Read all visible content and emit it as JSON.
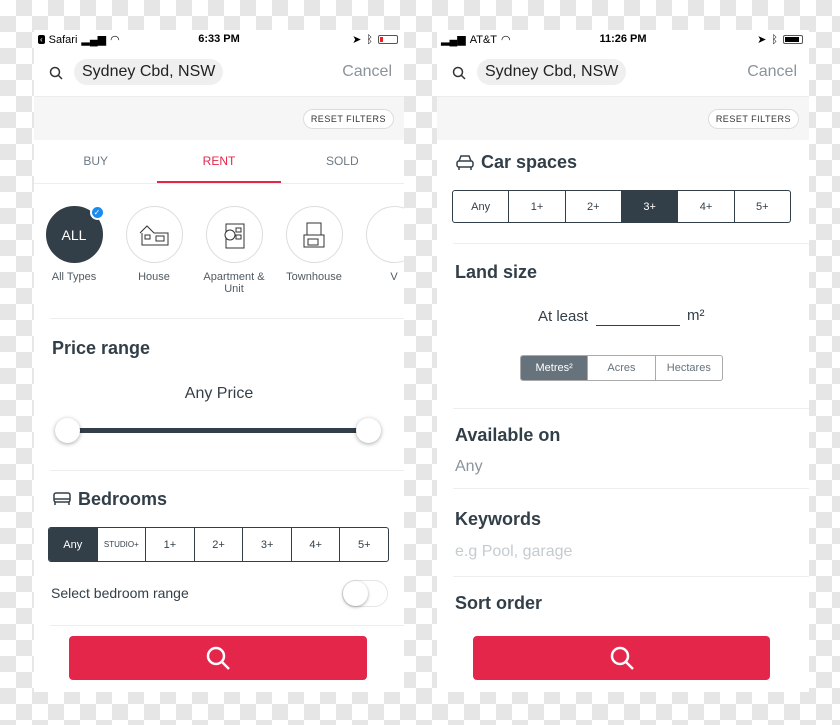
{
  "left": {
    "status": {
      "app": "Safari",
      "time": "6:33 PM"
    },
    "search": {
      "location": "Sydney Cbd, NSW",
      "cancel": "Cancel"
    },
    "reset": "RESET FILTERS",
    "tabs": [
      {
        "label": "BUY"
      },
      {
        "label": "RENT",
        "active": true
      },
      {
        "label": "SOLD"
      }
    ],
    "types": [
      {
        "icon": "ALL",
        "label": "All Types",
        "selected": true
      },
      {
        "label": "House"
      },
      {
        "label": "Apartment & Unit"
      },
      {
        "label": "Townhouse"
      },
      {
        "label": "V"
      }
    ],
    "price": {
      "title": "Price range",
      "value": "Any Price"
    },
    "bedrooms": {
      "title": "Bedrooms",
      "options": [
        "Any",
        "STUDIO+",
        "1+",
        "2+",
        "3+",
        "4+",
        "5+"
      ],
      "selected": "Any",
      "range_label": "Select bedroom range",
      "range_on": false
    }
  },
  "right": {
    "status": {
      "carrier": "AT&T",
      "time": "11:26 PM"
    },
    "search": {
      "location": "Sydney Cbd, NSW",
      "cancel": "Cancel"
    },
    "reset": "RESET FILTERS",
    "car": {
      "title": "Car spaces",
      "options": [
        "Any",
        "1+",
        "2+",
        "3+",
        "4+",
        "5+"
      ],
      "selected": "3+"
    },
    "land": {
      "title": "Land size",
      "prefix": "At least",
      "value": "",
      "unit": "m²",
      "units": [
        "Metres²",
        "Acres",
        "Hectares"
      ],
      "selected": "Metres²"
    },
    "available": {
      "title": "Available on",
      "value": "Any"
    },
    "keywords": {
      "title": "Keywords",
      "placeholder": "e.g Pool, garage"
    },
    "sort": {
      "title": "Sort order"
    }
  },
  "colors": {
    "accent": "#e4264b",
    "dark": "#333f48"
  }
}
